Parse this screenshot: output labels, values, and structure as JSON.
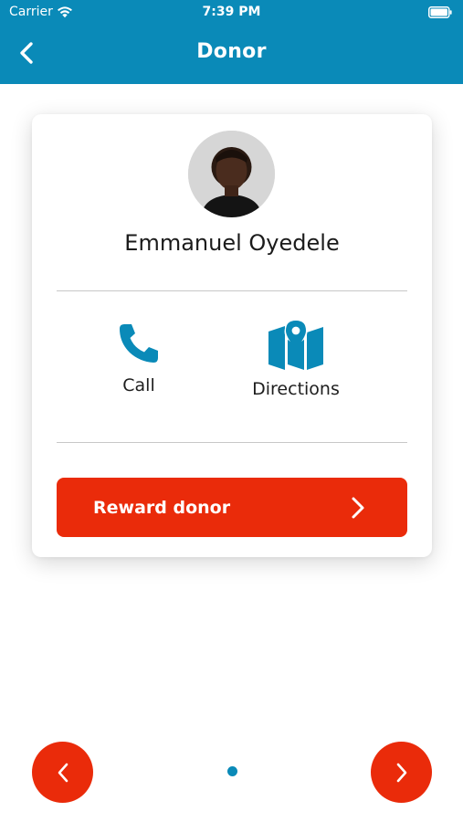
{
  "status_bar": {
    "carrier": "Carrier",
    "time": "7:39 PM"
  },
  "nav": {
    "title": "Donor",
    "back_icon": "chevron-left-icon"
  },
  "donor": {
    "name": "Emmanuel Oyedele"
  },
  "actions": {
    "call_label": "Call",
    "directions_label": "Directions"
  },
  "reward_button": {
    "label": "Reward donor"
  },
  "pager": {
    "active_index": 0,
    "total": 1
  },
  "colors": {
    "header": "#0a8ab8",
    "accent": "#ea2b0a",
    "icon_blue": "#0a8ab8"
  }
}
